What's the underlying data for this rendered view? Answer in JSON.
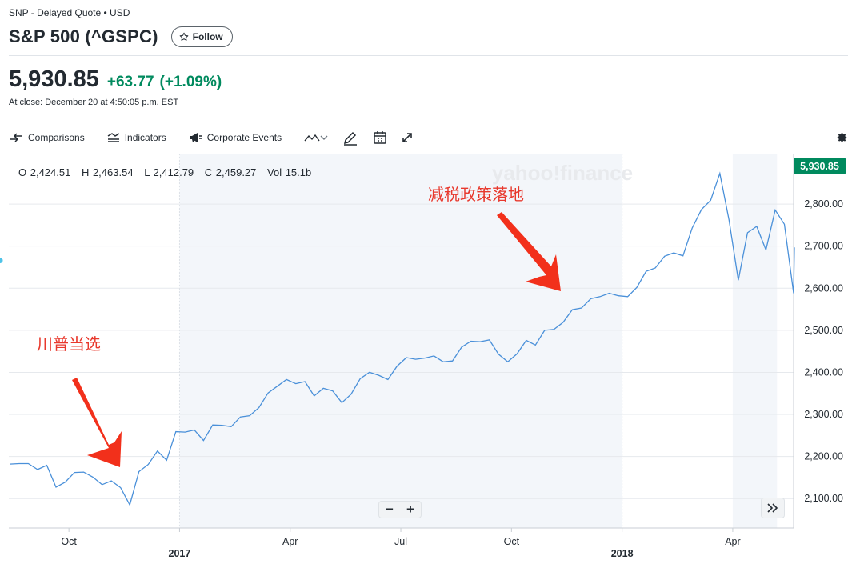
{
  "header": {
    "exchange_line": "SNP - Delayed Quote • USD",
    "title": "S&P 500 (^GSPC)",
    "follow_label": "Follow"
  },
  "quote": {
    "price": "5,930.85",
    "change": "+63.77",
    "change_pct": "(+1.09%)",
    "close_time": "At close: December 20 at 4:50:05 p.m. EST",
    "up_color": "#008a5e"
  },
  "toolbar": {
    "comparisons_label": "Comparisons",
    "indicators_label": "Indicators",
    "corporate_events_label": "Corporate Events",
    "icons": [
      "comparisons-icon",
      "indicators-icon",
      "megaphone-icon",
      "line-chart-type-icon",
      "draw-icon",
      "calendar-icon",
      "expand-icon",
      "gear-icon"
    ]
  },
  "ohlc": {
    "open": "O 2,424.51",
    "high": "H 2,463.54",
    "low": "L 2,412.79",
    "close": "C 2,459.27",
    "volume": "Vol 15.1b"
  },
  "watermark": "yahoo!finance",
  "price_badge": "5,930.85",
  "annotations": {
    "trump_elected": "川普当选",
    "tax_cut": "减税政策落地",
    "arrow_color": "#f2301b"
  },
  "zoom": {
    "minus": "−",
    "plus": "+"
  },
  "chart_data": {
    "type": "line",
    "x_unit": "weekly closes (month index, 0 = Aug 2016)",
    "x": [
      0.4,
      0.65,
      0.9,
      1.15,
      1.4,
      1.65,
      1.9,
      2.15,
      2.4,
      2.65,
      2.9,
      3.15,
      3.4,
      3.65,
      3.9,
      4.15,
      4.4,
      4.65,
      4.9,
      5.15,
      5.4,
      5.65,
      5.9,
      6.15,
      6.4,
      6.65,
      6.9,
      7.15,
      7.4,
      7.65,
      7.9,
      8.15,
      8.4,
      8.65,
      8.9,
      9.15,
      9.4,
      9.65,
      9.9,
      10.15,
      10.4,
      10.65,
      10.9,
      11.15,
      11.4,
      11.65,
      11.9,
      12.15,
      12.4,
      12.65,
      12.9,
      13.15,
      13.4,
      13.65,
      13.9,
      14.15,
      14.4,
      14.65,
      14.9,
      15.15,
      15.4,
      15.65,
      15.9,
      16.15,
      16.4,
      16.65,
      16.9,
      17.15,
      17.4,
      17.65,
      17.9,
      18.15,
      18.4,
      18.65,
      18.9,
      19.15,
      19.4,
      19.65,
      19.9,
      20.15,
      20.4,
      20.65,
      20.9,
      21.15,
      21.4,
      21.65
    ],
    "y": [
      2182,
      2183,
      2183,
      2169,
      2179,
      2127,
      2139,
      2162,
      2163,
      2151,
      2133,
      2142,
      2126,
      2085,
      2164,
      2181,
      2213,
      2191,
      2259,
      2258,
      2263,
      2238,
      2275,
      2274,
      2271,
      2294,
      2297,
      2316,
      2351,
      2367,
      2383,
      2373,
      2378,
      2344,
      2362,
      2356,
      2328,
      2348,
      2385,
      2400,
      2393,
      2383,
      2415,
      2435,
      2431,
      2434,
      2439,
      2425,
      2427,
      2460,
      2474,
      2473,
      2477,
      2443,
      2425,
      2444,
      2476,
      2465,
      2500,
      2502,
      2519,
      2549,
      2553,
      2575,
      2580,
      2588,
      2582,
      2580,
      2602,
      2640,
      2648,
      2676,
      2684,
      2677,
      2743,
      2787,
      2809,
      2873,
      2762,
      2619,
      2732,
      2747,
      2691,
      2786,
      2752,
      2588,
      2640,
      2605,
      2656,
      2670,
      2670,
      2666,
      2697
    ],
    "x_ticks": [
      {
        "label": "Oct",
        "x": 2,
        "bold": false
      },
      {
        "label": "2017",
        "x": 5,
        "bold": true
      },
      {
        "label": "Apr",
        "x": 8,
        "bold": false
      },
      {
        "label": "Jul",
        "x": 11,
        "bold": false
      },
      {
        "label": "Oct",
        "x": 14,
        "bold": false
      },
      {
        "label": "2018",
        "x": 17,
        "bold": true
      },
      {
        "label": "Apr",
        "x": 20,
        "bold": false
      }
    ],
    "y_ticks": [
      "2,100.00",
      "2,200.00",
      "2,300.00",
      "2,400.00",
      "2,500.00",
      "2,600.00",
      "2,700.00",
      "2,800.00"
    ],
    "ylim": [
      2030,
      2920
    ],
    "line_color": "#4a90d9",
    "shaded_ranges": [
      [
        5,
        17
      ],
      [
        20,
        21.2
      ]
    ]
  }
}
